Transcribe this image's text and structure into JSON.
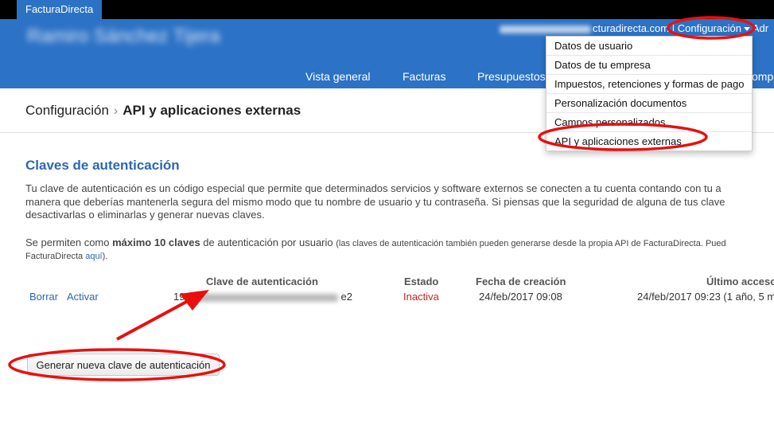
{
  "app": {
    "brand_tab": "FacturaDirecta"
  },
  "header": {
    "user_name": "Ramiro Sánchez Tijera",
    "account_email_tail": "cturadirecta.com",
    "separator": "|",
    "config_menu_label": "Configuración",
    "admin_label_partial": "Adr"
  },
  "nav": {
    "items": [
      "Vista general",
      "Facturas",
      "Presupuestos",
      "omp"
    ]
  },
  "dropdown": {
    "items": [
      "Datos de usuario",
      "Datos de tu empresa",
      "Impuestos, retenciones y formas de pago",
      "Personalización documentos",
      "Campos personalizados",
      "API y aplicaciones externas"
    ]
  },
  "breadcrumb": {
    "parent": "Configuración",
    "separator": "›",
    "current": "API y aplicaciones externas"
  },
  "section": {
    "title": "Claves de autenticación",
    "paragraph_lines": [
      "Tu clave de autenticación es un código especial que permite que determinados servicios y software externos se conecten a tu cuenta contando con tu a",
      "manera que deberías mantenerla segura del mismo modo que tu nombre de usuario y tu contraseña. Si piensas que la seguridad de alguna de tus clave",
      "desactivarlas o eliminarlas y generar nuevas claves."
    ],
    "limit_text_before": "Se permiten como ",
    "limit_text_bold": "máximo 10 claves",
    "limit_text_after": " de autenticación por usuario ",
    "limit_note": "(las claves de autenticación también pueden generarse desde la propia API de FacturaDirecta. Pued",
    "limit_note_line2_before": "FacturaDirecta ",
    "limit_note_link": "aquí",
    "limit_note_line2_after": ")."
  },
  "table": {
    "headers": {
      "key": "Clave de autenticación",
      "status": "Estado",
      "created": "Fecha de creación",
      "last_access": "Último acceso"
    },
    "rows": [
      {
        "delete_label": "Borrar",
        "activate_label": "Activar",
        "key_start": "19",
        "key_end": "e2",
        "status": "Inactiva",
        "created": "24/feb/2017 09:08",
        "last_access": "24/feb/2017 09:23 (1 año, 5 m"
      }
    ]
  },
  "actions": {
    "generate_button": "Generar nueva clave de autenticación"
  },
  "colors": {
    "header_blue": "#2c72c6",
    "link_blue": "#2b67b2",
    "inactive_red": "#c8261e",
    "annotation_red": "#e8100f"
  }
}
